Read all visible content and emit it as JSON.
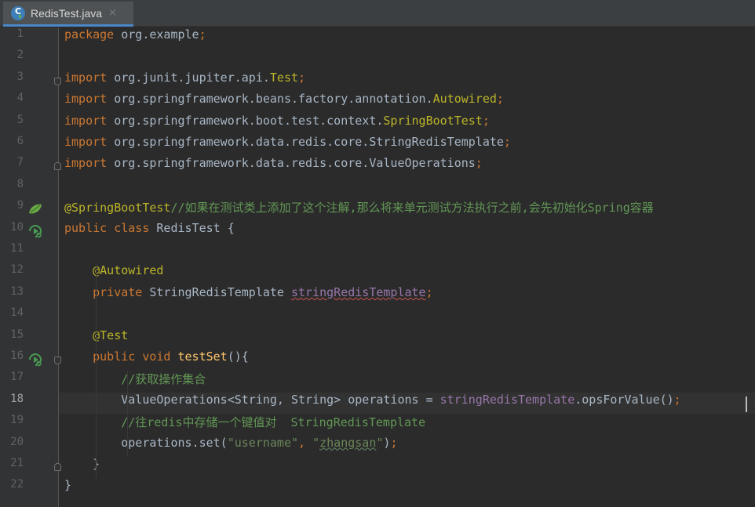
{
  "tab": {
    "filename": "RedisTest.java",
    "icon": "java-class-icon",
    "close": "×"
  },
  "editor": {
    "current_line": "18",
    "lines": [
      {
        "n": "1",
        "tokens": [
          {
            "c": "kw",
            "t": "package "
          },
          {
            "c": "pl",
            "t": "org.example"
          },
          {
            "c": "kw",
            "t": ";"
          }
        ]
      },
      {
        "n": "2",
        "tokens": []
      },
      {
        "n": "3",
        "tokens": [
          {
            "c": "kw",
            "t": "import "
          },
          {
            "c": "pl",
            "t": "org.junit.jupiter.api."
          },
          {
            "c": "an",
            "t": "Test"
          },
          {
            "c": "kw",
            "t": ";"
          }
        ]
      },
      {
        "n": "4",
        "tokens": [
          {
            "c": "kw",
            "t": "import "
          },
          {
            "c": "pl",
            "t": "org.springframework.beans.factory.annotation."
          },
          {
            "c": "an",
            "t": "Autowired"
          },
          {
            "c": "kw",
            "t": ";"
          }
        ]
      },
      {
        "n": "5",
        "tokens": [
          {
            "c": "kw",
            "t": "import "
          },
          {
            "c": "pl",
            "t": "org.springframework.boot.test.context."
          },
          {
            "c": "an",
            "t": "SpringBootTest"
          },
          {
            "c": "kw",
            "t": ";"
          }
        ]
      },
      {
        "n": "6",
        "tokens": [
          {
            "c": "kw",
            "t": "import "
          },
          {
            "c": "pl",
            "t": "org.springframework.data.redis.core.StringRedisTemplate"
          },
          {
            "c": "kw",
            "t": ";"
          }
        ]
      },
      {
        "n": "7",
        "tokens": [
          {
            "c": "kw",
            "t": "import "
          },
          {
            "c": "pl",
            "t": "org.springframework.data.redis.core.ValueOperations"
          },
          {
            "c": "kw",
            "t": ";"
          }
        ]
      },
      {
        "n": "8",
        "tokens": []
      },
      {
        "n": "9",
        "tokens": [
          {
            "c": "an",
            "t": "@SpringBootTest"
          },
          {
            "c": "cm",
            "t": "//如果在测试类上添加了这个注解,那么将来单元测试方法执行之前,会先初始化Spring容器"
          }
        ]
      },
      {
        "n": "10",
        "tokens": [
          {
            "c": "kw",
            "t": "public class "
          },
          {
            "c": "pl",
            "t": "RedisTest {"
          }
        ]
      },
      {
        "n": "11",
        "tokens": []
      },
      {
        "n": "12",
        "tokens": [
          {
            "c": "pl",
            "t": "    "
          },
          {
            "c": "an",
            "t": "@Autowired"
          }
        ]
      },
      {
        "n": "13",
        "tokens": [
          {
            "c": "pl",
            "t": "    "
          },
          {
            "c": "kw",
            "t": "private "
          },
          {
            "c": "pl",
            "t": "StringRedisTemplate "
          },
          {
            "c": "fld sq",
            "t": "stringRedisTemplate"
          },
          {
            "c": "kw",
            "t": ";"
          }
        ]
      },
      {
        "n": "14",
        "tokens": []
      },
      {
        "n": "15",
        "tokens": [
          {
            "c": "pl",
            "t": "    "
          },
          {
            "c": "an",
            "t": "@Test"
          }
        ]
      },
      {
        "n": "16",
        "tokens": [
          {
            "c": "pl",
            "t": "    "
          },
          {
            "c": "kw",
            "t": "public void "
          },
          {
            "c": "fn",
            "t": "testSet"
          },
          {
            "c": "pl",
            "t": "(){"
          }
        ]
      },
      {
        "n": "17",
        "tokens": [
          {
            "c": "pl",
            "t": "        "
          },
          {
            "c": "cm",
            "t": "//获取操作集合"
          }
        ]
      },
      {
        "n": "18",
        "tokens": [
          {
            "c": "pl",
            "t": "        ValueOperations<String, String> operations = "
          },
          {
            "c": "fld",
            "t": "stringRedisTemplate"
          },
          {
            "c": "pl",
            "t": ".opsForValue()"
          },
          {
            "c": "kw",
            "t": ";"
          }
        ]
      },
      {
        "n": "19",
        "tokens": [
          {
            "c": "pl",
            "t": "        "
          },
          {
            "c": "cm",
            "t": "//往redis中存储一个键值对  StringRedisTemplate"
          }
        ]
      },
      {
        "n": "20",
        "tokens": [
          {
            "c": "pl",
            "t": "        operations.set("
          },
          {
            "c": "str",
            "t": "\"username\""
          },
          {
            "c": "kw",
            "t": ", "
          },
          {
            "c": "str",
            "t": "\""
          },
          {
            "c": "str sq2",
            "t": "zhangsan"
          },
          {
            "c": "str",
            "t": "\""
          },
          {
            "c": "pl",
            "t": ")"
          },
          {
            "c": "kw",
            "t": ";"
          }
        ]
      },
      {
        "n": "21",
        "tokens": [
          {
            "c": "pl",
            "t": "    }"
          }
        ]
      },
      {
        "n": "22",
        "tokens": [
          {
            "c": "pl",
            "t": "}"
          }
        ]
      }
    ],
    "gutter_icons": [
      {
        "line": "9",
        "icon": "spring-bean-icon"
      },
      {
        "line": "10",
        "icon": "run-test-icon"
      },
      {
        "line": "16",
        "icon": "run-test-icon"
      }
    ],
    "folds": [
      {
        "line": "3",
        "kind": "open"
      },
      {
        "line": "7",
        "kind": "close"
      },
      {
        "line": "16",
        "kind": "open"
      },
      {
        "line": "21",
        "kind": "close"
      }
    ]
  }
}
